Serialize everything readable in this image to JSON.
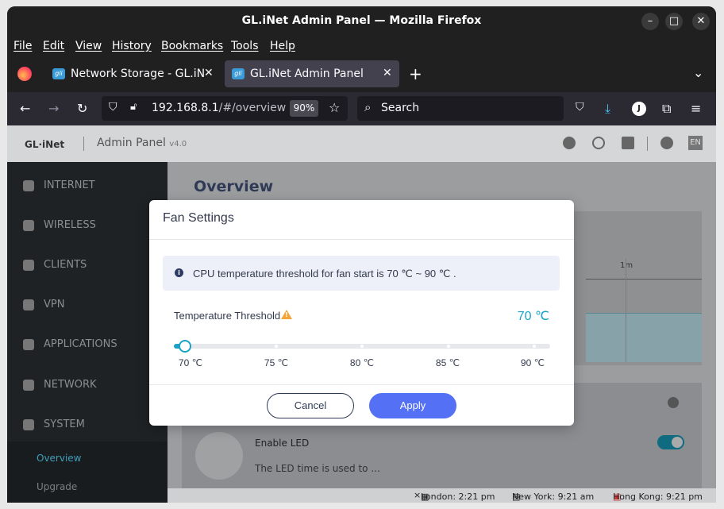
{
  "window": {
    "title": "GL.iNet Admin Panel — Mozilla Firefox"
  },
  "menu": [
    "File",
    "Edit",
    "View",
    "History",
    "Bookmarks",
    "Tools",
    "Help"
  ],
  "tabs": [
    {
      "label": "Network Storage - GL.iNe",
      "favicon": "gli",
      "active": false
    },
    {
      "label": "GL.iNet Admin Panel",
      "favicon": "gli",
      "active": true
    }
  ],
  "nav": {
    "url_host": "192.168.8.1",
    "url_path": "/#/overview",
    "zoom": "90%",
    "search_placeholder": "Search",
    "account_initial": "J"
  },
  "app": {
    "logo": "GL·iNet",
    "title": "Admin Panel",
    "version": "v4.0",
    "lang": "EN",
    "page_title": "Overview",
    "sidebar": [
      {
        "label": "INTERNET",
        "icon": "globe-icon"
      },
      {
        "label": "WIRELESS",
        "icon": "wifi-icon"
      },
      {
        "label": "CLIENTS",
        "icon": "devices-icon"
      },
      {
        "label": "VPN",
        "icon": "shield-icon"
      },
      {
        "label": "APPLICATIONS",
        "icon": "apps-icon"
      },
      {
        "label": "NETWORK",
        "icon": "network-icon"
      },
      {
        "label": "SYSTEM",
        "icon": "gear-icon"
      }
    ],
    "subitems": [
      {
        "label": "Overview",
        "active": true
      },
      {
        "label": "Upgrade",
        "active": false
      }
    ],
    "chart_tick": "1m",
    "led_label": "Enable LED",
    "led_desc": "The LED time is used to ..."
  },
  "statusbar": {
    "london": "London: 2:21 pm",
    "newyork": "New York: 9:21 am",
    "hongkong": "Hong Kong: 9:21 pm"
  },
  "modal": {
    "title": "Fan Settings",
    "info": "CPU temperature threshold for fan start is 70 ℃ ~ 90 ℃ .",
    "threshold_label": "Temperature Threshold",
    "threshold_value": "70 ℃",
    "slider_value": 0,
    "ticks": [
      "70 ℃",
      "75 ℃",
      "80 ℃",
      "85 ℃",
      "90 ℃"
    ],
    "cancel": "Cancel",
    "apply": "Apply"
  },
  "colors": {
    "accent": "#1aa3c6",
    "apply": "#5470f5",
    "warning": "#f2a63a"
  }
}
